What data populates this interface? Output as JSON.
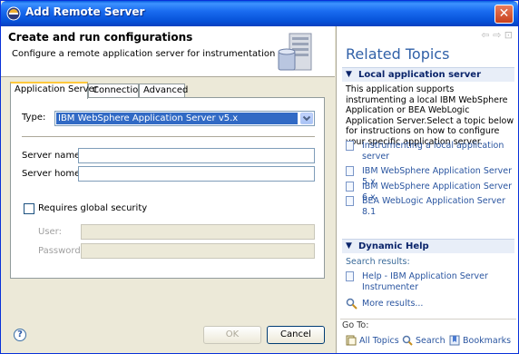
{
  "window": {
    "title": "Add Remote Server",
    "close_glyph": "✕",
    "title_icon": "eclipse-icon"
  },
  "banner": {
    "title": "Create and run configurations",
    "description": "Configure a remote application server for instrumentation",
    "image": "server-stack-icon"
  },
  "tabs": [
    {
      "label": "Application Server",
      "active": true
    },
    {
      "label": "Connection",
      "active": false
    },
    {
      "label": "Advanced",
      "active": false
    }
  ],
  "form": {
    "type_label": "Type:",
    "type_value": "IBM WebSphere Application Server v5.x",
    "server_name_label": "Server name:",
    "server_name_value": "",
    "server_home_label": "Server home:",
    "server_home_value": "",
    "security_label": "Requires global security",
    "security_checked": false,
    "user_label": "User:",
    "user_value": "",
    "password_label": "Password:",
    "password_value": ""
  },
  "buttons": {
    "help_glyph": "?",
    "ok": "OK",
    "cancel": "Cancel"
  },
  "help": {
    "title": "Related Topics",
    "nav_back": "⇦",
    "nav_forward": "⇨",
    "nav_home": "⊡",
    "local_section": "Local application server",
    "local_text": "This application supports instrumenting a local IBM WebSphere Application or BEA WebLogic Application Server.Select a topic below for instructions on how to configure your specific application server.",
    "links": [
      "Instrumenting a local application server",
      "IBM WebSphere Application Server 5.x",
      "IBM WebSphere Application Server 6.x",
      "BEA WebLogic Application Server 8.1"
    ],
    "dynamic_section": "Dynamic Help",
    "search_results_label": "Search results:",
    "result_link": "Help - IBM Application Server Instrumenter",
    "more_results": "More results...",
    "goto_label": "Go To:",
    "footer": {
      "all_topics": "All Topics",
      "search": "Search",
      "bookmarks": "Bookmarks"
    }
  },
  "colors": {
    "title_bar": "#0a5fe0",
    "selection": "#316ac5",
    "link": "#2a55a0",
    "heading": "#3161a8"
  }
}
